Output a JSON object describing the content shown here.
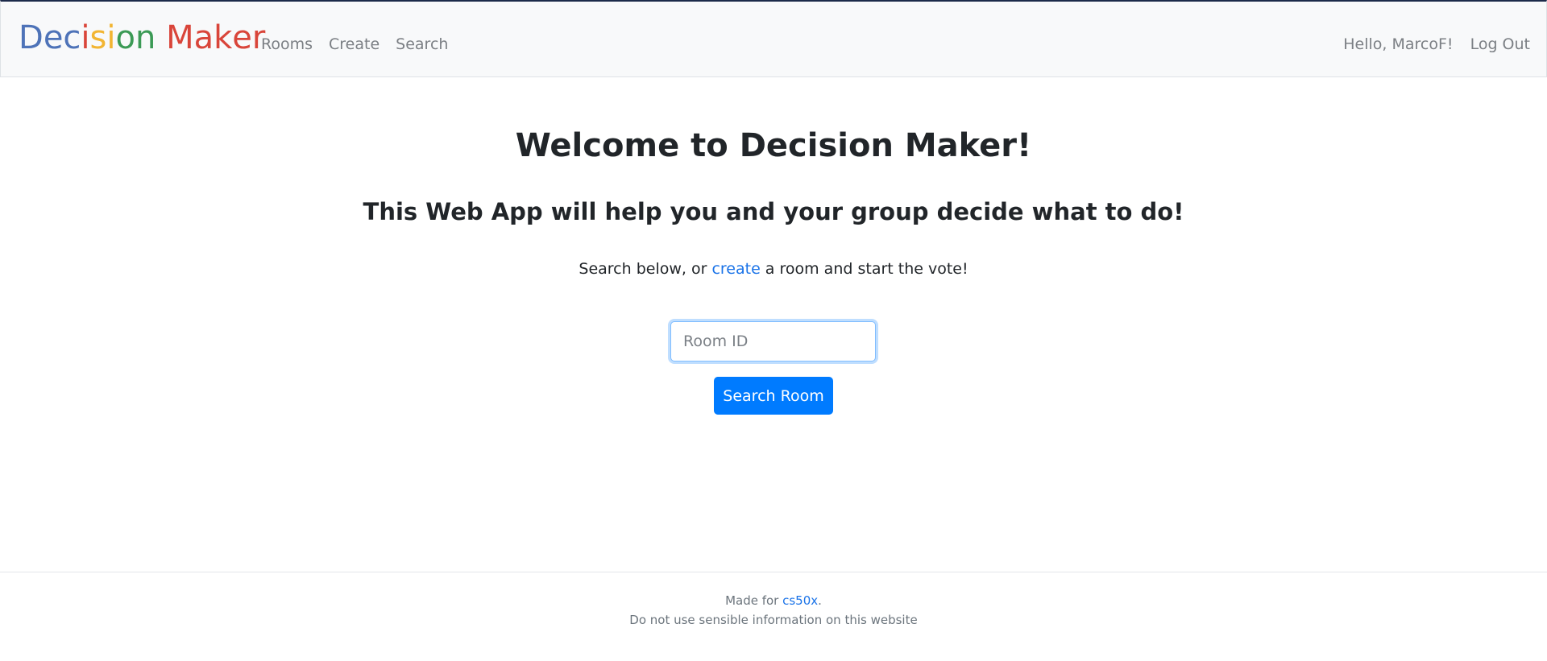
{
  "navbar": {
    "brand": [
      {
        "text": "D",
        "color": "#4e73b8"
      },
      {
        "text": "e",
        "color": "#4e73b8"
      },
      {
        "text": "c",
        "color": "#4e73b8"
      },
      {
        "text": "i",
        "color": "#d9453a"
      },
      {
        "text": "s",
        "color": "#f2b532"
      },
      {
        "text": "i",
        "color": "#f2b532"
      },
      {
        "text": "o",
        "color": "#3b9a55"
      },
      {
        "text": "n",
        "color": "#3b9a55"
      },
      {
        "text": " ",
        "color": "#3b9a55"
      },
      {
        "text": "M",
        "color": "#d9453a"
      },
      {
        "text": "a",
        "color": "#d9453a"
      },
      {
        "text": "k",
        "color": "#d9453a"
      },
      {
        "text": "e",
        "color": "#d9453a"
      },
      {
        "text": "r",
        "color": "#d9453a"
      }
    ],
    "links": {
      "rooms": "Rooms",
      "create": "Create",
      "search": "Search"
    },
    "greeting": "Hello, MarcoF!",
    "logout": "Log Out"
  },
  "main": {
    "title": "Welcome to Decision Maker!",
    "subtitle": "This Web App will help you and your group decide what to do!",
    "lead_before": "Search below, or ",
    "lead_link": "create",
    "lead_after": " a room and start the vote!",
    "room_input_placeholder": "Room ID",
    "room_input_value": "",
    "search_button": "Search Room"
  },
  "footer": {
    "made_for_prefix": "Made for ",
    "made_for_link": "cs50x",
    "made_for_suffix": ".",
    "disclaimer": "Do not use sensible information on this website"
  },
  "colors": {
    "primary": "#007bff",
    "link": "#1a73e8",
    "navbar_bg": "#f8f9fa"
  }
}
